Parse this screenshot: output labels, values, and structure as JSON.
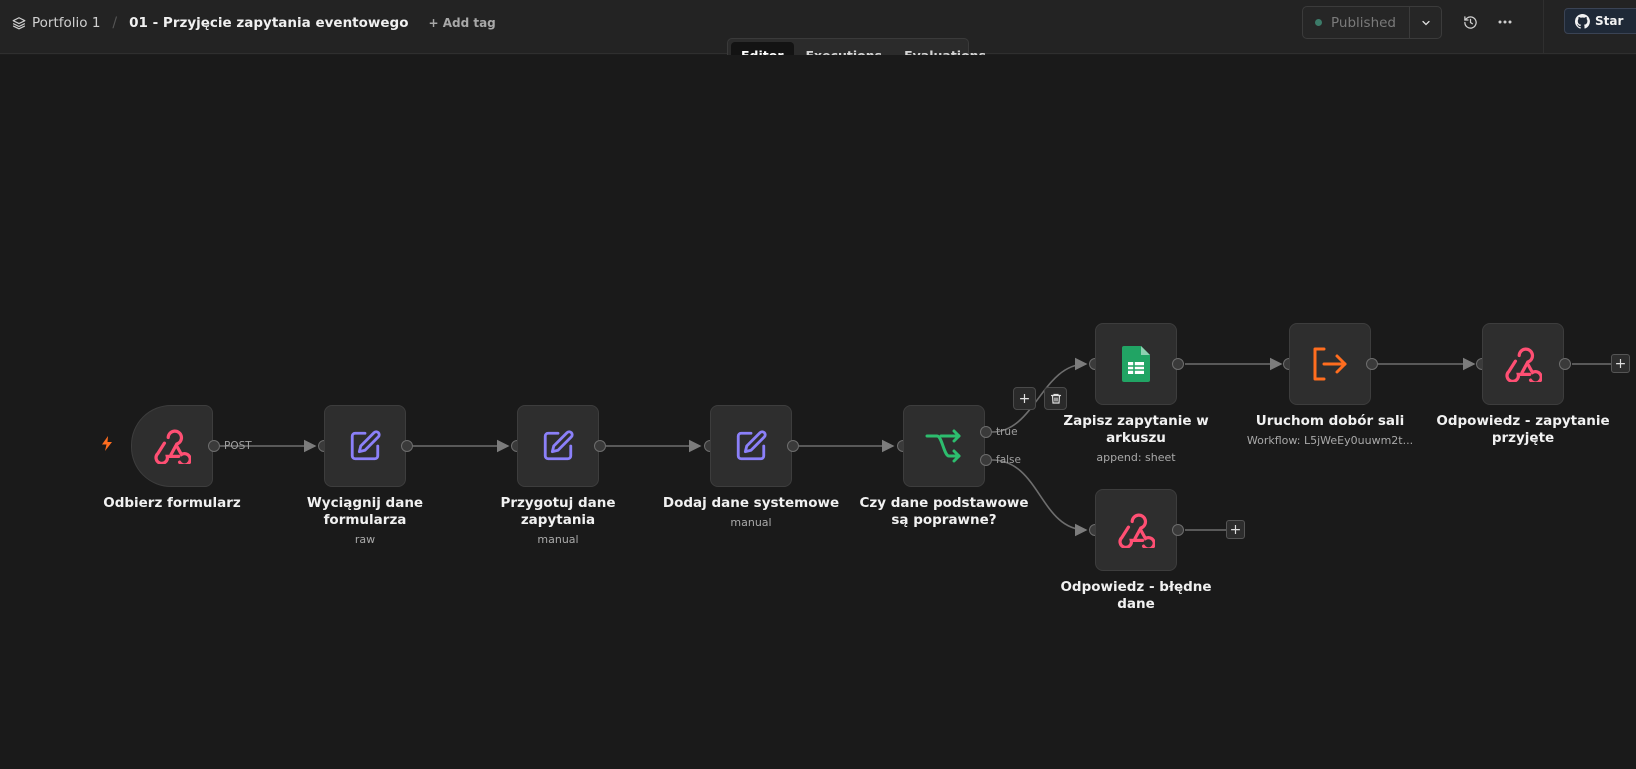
{
  "header": {
    "project": "Portfolio 1",
    "workflow_title": "01 - Przyjęcie zapytania eventowego",
    "add_tag": "+ Add tag",
    "publish_status": "Published",
    "star_label": "Star"
  },
  "tabs": [
    "Editor",
    "Executions",
    "Evaluations"
  ],
  "active_tab": "Editor",
  "nodes": {
    "n1": {
      "label": "Odbierz formularz",
      "icon": "webhook-icon"
    },
    "n2": {
      "label": "Wyciągnij dane formularza",
      "sub": "raw",
      "icon": "edit-icon"
    },
    "n3": {
      "label": "Przygotuj dane zapytania",
      "sub": "manual",
      "icon": "edit-icon"
    },
    "n4": {
      "label": "Dodaj dane systemowe",
      "sub": "manual",
      "icon": "edit-icon"
    },
    "n5": {
      "label": "Czy dane podstawowe są poprawne?",
      "icon": "if-icon"
    },
    "n6": {
      "label": "Zapisz zapytanie w arkuszu",
      "sub": "append: sheet",
      "icon": "google-sheets-icon"
    },
    "n7": {
      "label": "Uruchom dobór sali",
      "sub": "Workflow: L5jWeEy0uuwm2t...",
      "icon": "execute-workflow-icon"
    },
    "n8": {
      "label": "Odpowiedz - zapytanie przyjęte",
      "icon": "webhook-icon"
    },
    "n9": {
      "label": "Odpowiedz - błędne dane",
      "icon": "webhook-icon"
    }
  },
  "edge_labels": {
    "post": "POST",
    "true": "true",
    "false": "false"
  },
  "colors": {
    "canvas_bg": "#1a1a1a",
    "webhook": "#ff4f73",
    "edit": "#8b80f9",
    "if": "#2dbd6e",
    "sheets": "#21a464",
    "execute": "#ff6d1f",
    "trigger_bolt": "#ff6d1f"
  }
}
